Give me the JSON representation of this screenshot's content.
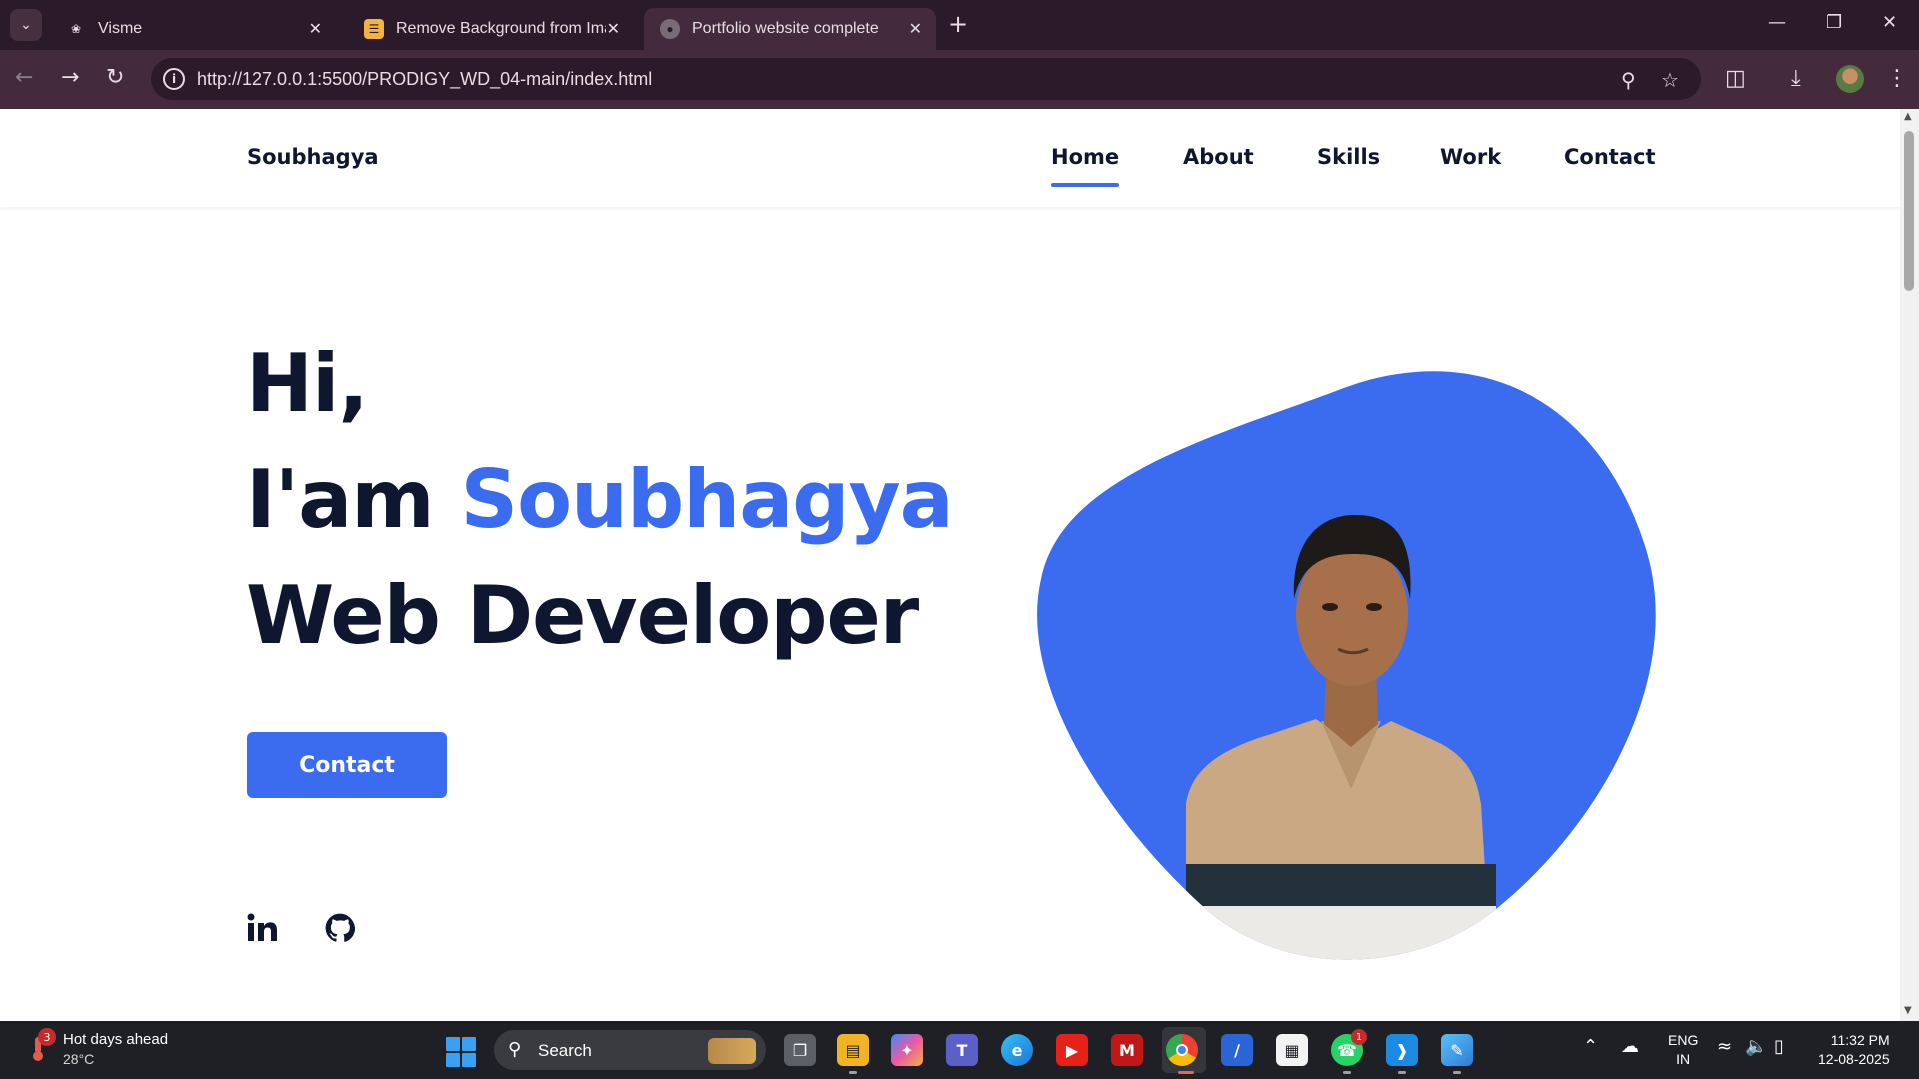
{
  "browser": {
    "tabs": [
      {
        "title": "Visme",
        "active": false
      },
      {
        "title": "Remove Background from Imag",
        "active": false
      },
      {
        "title": "Portfolio website complete",
        "active": true
      }
    ],
    "new_tab_symbol": "+",
    "url": "http://127.0.0.1:5500/PRODIGY_WD_04-main/index.html",
    "icons": [
      "tab-search-icon",
      "back-icon",
      "forward-icon",
      "reload-icon",
      "site-info-icon",
      "zoom-icon",
      "star-icon",
      "extensions-icon",
      "download-icon",
      "profile-avatar",
      "menu-icon",
      "minimize-icon",
      "restore-icon",
      "close-icon"
    ]
  },
  "site": {
    "logo": "Soubhagya",
    "nav": [
      {
        "label": "Home",
        "active": true
      },
      {
        "label": "About",
        "active": false
      },
      {
        "label": "Skills",
        "active": false
      },
      {
        "label": "Work",
        "active": false
      },
      {
        "label": "Contact",
        "active": false
      }
    ],
    "hero": {
      "greeting": "Hi,",
      "intro_prefix": "I'am ",
      "name": "Soubhagya",
      "role": "Web Developer",
      "cta_label": "Contact"
    },
    "social_icons": [
      "linkedin-icon",
      "github-icon"
    ],
    "colors": {
      "accent": "#3b6cf0",
      "text": "#0e1630",
      "button_text": "#ffffff"
    }
  },
  "taskbar": {
    "weather": {
      "title": "Hot days ahead",
      "temp": "28°C",
      "badge": "3"
    },
    "search_label": "Search",
    "apps": [
      "task-view-icon",
      "file-explorer-icon",
      "copilot-icon",
      "teams-icon",
      "edge-icon",
      "youtube-icon",
      "mcafee-icon",
      "chrome-icon",
      "remote-desktop-icon",
      "microsoft-store-icon",
      "whatsapp-icon",
      "vscode-icon",
      "paint-icon"
    ],
    "whatsapp_badge": "1",
    "language": {
      "line1": "ENG",
      "line2": "IN"
    },
    "clock": {
      "time": "11:32 PM",
      "date": "12-08-2025"
    }
  }
}
